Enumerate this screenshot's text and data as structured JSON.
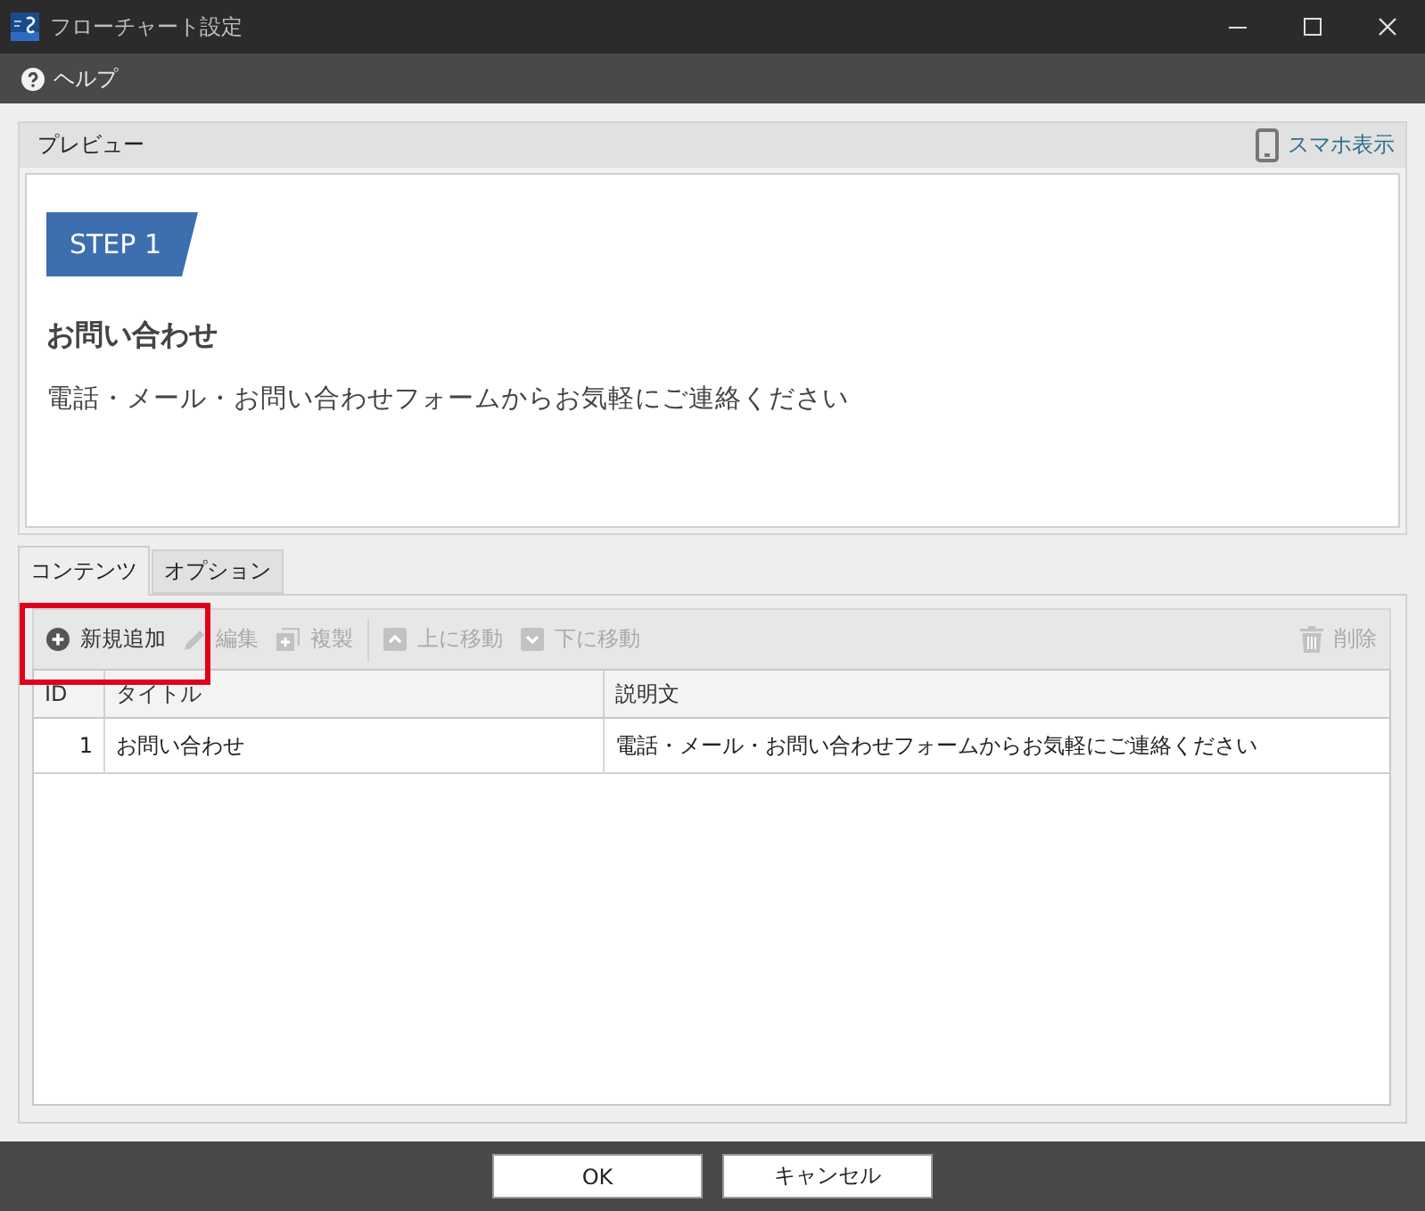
{
  "window": {
    "title": "フローチャート設定"
  },
  "menu": [
    {
      "label": "ヘルプ"
    }
  ],
  "preview": {
    "title": "プレビュー",
    "mobile_view": "スマホ表示",
    "step_badge": "STEP 1",
    "heading": "お問い合わせ",
    "description": "電話・メール・お問い合わせフォームからお気軽にご連絡ください"
  },
  "tabs": [
    {
      "label": "コンテンツ",
      "selected": true
    },
    {
      "label": "オプション",
      "selected": false
    }
  ],
  "toolbar": {
    "groups": [
      {
        "buttons": [
          {
            "label": "新規追加",
            "kind": "add",
            "disabled": false,
            "highlighted": true
          },
          {
            "label": "編集",
            "kind": "edit",
            "disabled": true,
            "highlighted": false
          },
          {
            "label": "複製",
            "kind": "copy",
            "disabled": true,
            "highlighted": false
          }
        ]
      },
      {
        "buttons": [
          {
            "label": "上に移動",
            "kind": "up",
            "disabled": true,
            "highlighted": false
          },
          {
            "label": "下に移動",
            "kind": "down",
            "disabled": true,
            "highlighted": false
          }
        ]
      }
    ],
    "end_buttons": [
      {
        "label": "削除",
        "kind": "delete",
        "disabled": true,
        "highlighted": false
      }
    ]
  },
  "table": {
    "columns": [
      {
        "label": "ID",
        "kind": "number"
      },
      {
        "label": "タイトル",
        "kind": "text"
      },
      {
        "label": "説明文",
        "kind": "text"
      }
    ],
    "rows": [
      [
        "1",
        "お問い合わせ",
        "電話・メール・お問い合わせフォームからお気軽にご連絡ください"
      ]
    ]
  },
  "buttons": [
    "OK",
    "キャンセル"
  ]
}
